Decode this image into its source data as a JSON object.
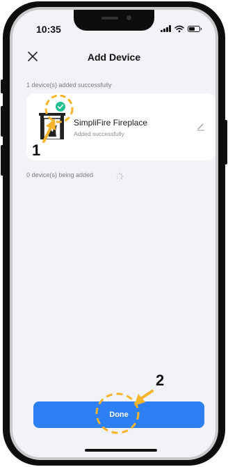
{
  "status_bar": {
    "time": "10:35"
  },
  "header": {
    "close_icon": "close-icon",
    "title": "Add Device"
  },
  "added_section": {
    "label": "1 device(s) added successfully"
  },
  "device": {
    "name": "SimpliFire Fireplace",
    "status": "Added successfully",
    "icon": "fireplace-icon",
    "check_icon": "check-badge-icon",
    "edit_icon": "pencil-icon"
  },
  "adding_section": {
    "label": "0 device(s) being added",
    "spinner_icon": "loading-spinner-icon"
  },
  "footer": {
    "done_label": "Done"
  },
  "annotations": {
    "step1": "1",
    "step2": "2"
  },
  "colors": {
    "accent": "#2e7ff3",
    "success": "#1fbf8f",
    "annotation": "#f5b42a",
    "screen_background": "#f2f3f7"
  }
}
